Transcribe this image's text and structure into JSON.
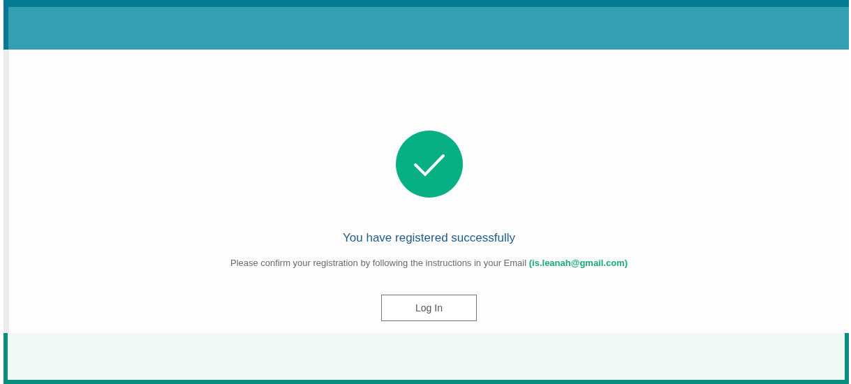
{
  "title": "You have registered successfully",
  "message": "Please confirm your registration by following the instructions in your Email **(is.leanah@gmail.com)**",
  "buttons": [
    "Log In"
  ]
}
